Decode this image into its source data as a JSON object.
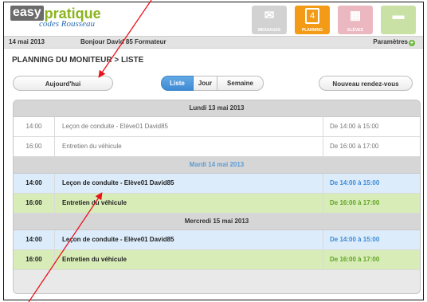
{
  "brand": {
    "name_part1": "easy",
    "name_part2": "pratique",
    "subtitle": "codes Rousseau"
  },
  "nav": [
    {
      "label": "MESSAGES",
      "icon": "envelope-icon",
      "state": "disabled"
    },
    {
      "label": "PLANNING",
      "icon": "calendar-icon",
      "state": "active",
      "badge": "4"
    },
    {
      "label": "ELÈVES",
      "icon": "students-icon",
      "state": "disabled"
    },
    {
      "label": "",
      "icon": "vehicle-icon",
      "state": "disabled"
    },
    {
      "label": "",
      "icon": "edit-icon",
      "state": "disabled"
    }
  ],
  "userbar": {
    "date": "14 mai 2013",
    "greeting": "Bonjour David 85 Formateur",
    "settings": "Paramètres"
  },
  "page": {
    "title": "PLANNING DU MONITEUR > LISTE"
  },
  "toolbar": {
    "today": "Aujourd'hui",
    "views": [
      "Liste",
      "Jour",
      "Semaine"
    ],
    "active_view": "Liste",
    "new_appointment": "Nouveau rendez-vous"
  },
  "days": [
    {
      "header": "Lundi 13 mai 2013",
      "rows": [
        {
          "time": "14:00",
          "title": "Leçon de conduite - Elève01 David85",
          "range": "De 14:00 à 15:00"
        },
        {
          "time": "16:00",
          "title": "Entretien du véhicule",
          "range": "De 16:00 à 17:00"
        }
      ]
    },
    {
      "header": "Mardi 14 mai 2013",
      "rows": [
        {
          "time": "14:00",
          "title": "Leçon de conduite - Elève01 David85",
          "range": "De 14:00 à 15:00"
        },
        {
          "time": "16:00",
          "title": "Entretien du véhicule",
          "range": "De 16:00 à 17:00"
        }
      ]
    },
    {
      "header": "Mercredi 15 mai 2013",
      "rows": [
        {
          "time": "14:00",
          "title": "Leçon de conduite - Elève01 David85",
          "range": "De 14:00 à 15:00"
        },
        {
          "time": "16:00",
          "title": "Entretien du véhicule",
          "range": "De 16:00 à 17:00"
        }
      ]
    }
  ],
  "colors": {
    "accent": "#3e8ad4",
    "lesson_bg": "#dcecfb",
    "maintenance_bg": "#d8ecb8",
    "annotation": "#e8141c"
  }
}
